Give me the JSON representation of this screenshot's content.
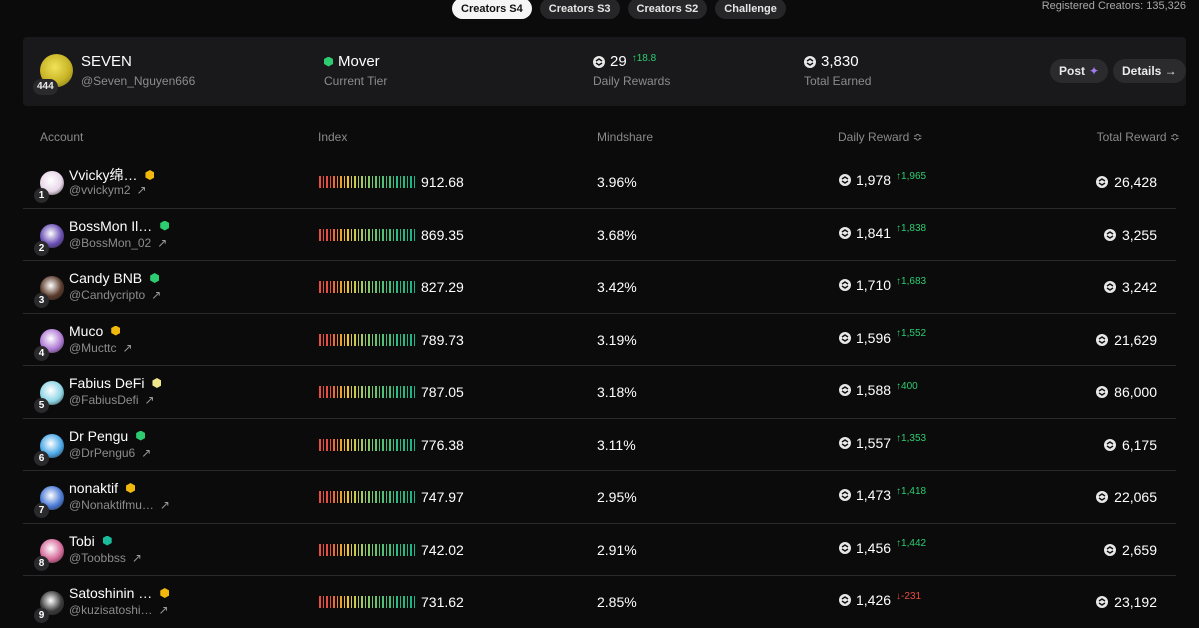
{
  "tabs": [
    {
      "label": "Creators S4",
      "active": true
    },
    {
      "label": "Creators S3",
      "active": false
    },
    {
      "label": "Creators S2",
      "active": false
    },
    {
      "label": "Challenge",
      "active": false
    }
  ],
  "registered": "Registered Creators: 135,326",
  "me": {
    "rank": "444",
    "name": "SEVEN",
    "handle": "@Seven_Nguyen666",
    "tier_value": "Mover",
    "tier_label": "Current Tier",
    "daily_value": "29",
    "daily_delta": "↑18.8",
    "daily_label": "Daily Rewards",
    "total_value": "3,830",
    "total_label": "Total Earned",
    "post_label": "Post",
    "details_label": "Details →"
  },
  "headers": {
    "account": "Account",
    "index": "Index",
    "mindshare": "Mindshare",
    "daily": "Daily Reward ≎",
    "total": "Total Reward ≎"
  },
  "rows": [
    {
      "rank": "1",
      "name": "Vvicky绵…",
      "handle": "@vvickym2",
      "index": "912.68",
      "mindshare": "3.96%",
      "daily": "1,978",
      "delta": "↑1,965",
      "dir": "up",
      "total": "26,428",
      "badge": "#f0b90b"
    },
    {
      "rank": "2",
      "name": "BossMon Il…",
      "handle": "@BossMon_02",
      "index": "869.35",
      "mindshare": "3.68%",
      "daily": "1,841",
      "delta": "↑1,838",
      "dir": "up",
      "total": "3,255",
      "badge": "#2ecc71"
    },
    {
      "rank": "3",
      "name": "Candy BNB",
      "handle": "@Candycripto",
      "index": "827.29",
      "mindshare": "3.42%",
      "daily": "1,710",
      "delta": "↑1,683",
      "dir": "up",
      "total": "3,242",
      "badge": "#2ecc71"
    },
    {
      "rank": "4",
      "name": "Muco",
      "handle": "@Mucttc",
      "index": "789.73",
      "mindshare": "3.19%",
      "daily": "1,596",
      "delta": "↑1,552",
      "dir": "up",
      "total": "21,629",
      "badge": "#f0b90b"
    },
    {
      "rank": "5",
      "name": "Fabius DeFi",
      "handle": "@FabiusDefi",
      "index": "787.05",
      "mindshare": "3.18%",
      "daily": "1,588",
      "delta": "↑400",
      "dir": "up",
      "total": "86,000",
      "badge": "#f0e68c"
    },
    {
      "rank": "6",
      "name": "Dr Pengu",
      "handle": "@DrPengu6",
      "index": "776.38",
      "mindshare": "3.11%",
      "daily": "1,557",
      "delta": "↑1,353",
      "dir": "up",
      "total": "6,175",
      "badge": "#2ecc71"
    },
    {
      "rank": "7",
      "name": "nonaktif",
      "handle": "@Nonaktifmu…",
      "index": "747.97",
      "mindshare": "2.95%",
      "daily": "1,473",
      "delta": "↑1,418",
      "dir": "up",
      "total": "22,065",
      "badge": "#f0b90b"
    },
    {
      "rank": "8",
      "name": "Tobi",
      "handle": "@Toobbss",
      "index": "742.02",
      "mindshare": "2.91%",
      "daily": "1,456",
      "delta": "↑1,442",
      "dir": "up",
      "total": "2,659",
      "badge": "#1abc9c"
    },
    {
      "rank": "9",
      "name": "Satoshinin …",
      "handle": "@kuzisatoshi…",
      "index": "731.62",
      "mindshare": "2.85%",
      "daily": "1,426",
      "delta": "↓-231",
      "dir": "down",
      "total": "23,192",
      "badge": "#f0b90b"
    }
  ],
  "avatar_colors": [
    "#e8d6e8",
    "#6a4fb5",
    "#5a3a2a",
    "#b07ad6",
    "#8fd6e6",
    "#4aa8e8",
    "#4a7ad6",
    "#d66a9a",
    "#3a3a3a"
  ],
  "icons": {
    "coin": "binance-coin-icon",
    "ext": "external-link-icon",
    "sparkle": "sparkle-icon"
  }
}
